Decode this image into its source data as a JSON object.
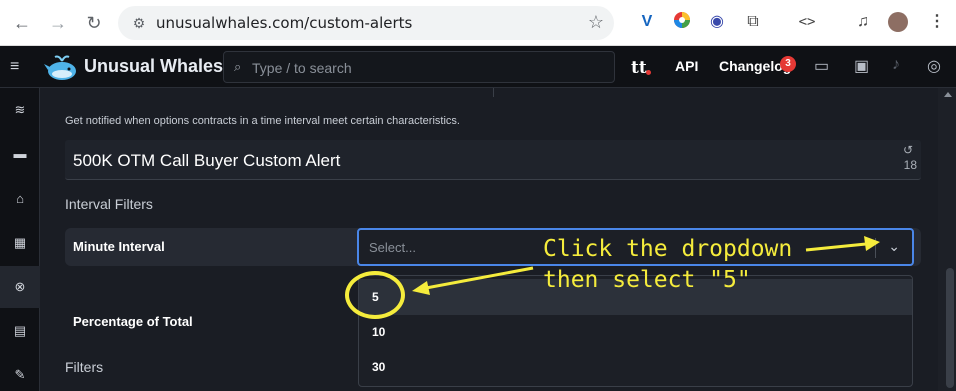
{
  "browser": {
    "url": "unusualwhales.com/custom-alerts",
    "back_icon": "←",
    "forward_icon": "→",
    "reload_icon": "↻",
    "site_icon": "⚙",
    "star_icon": "☆"
  },
  "header": {
    "menu_icon": "≡",
    "logo_text": "Unusual Whales",
    "search_icon": "⌕",
    "search_placeholder": "Type / to search",
    "tt_label": "tt",
    "api_label": "API",
    "changelog_label": "Changelog",
    "changelog_badge": "3"
  },
  "form": {
    "description": "Get notified when options contracts in a time interval meet certain characteristics.",
    "alert_name": "500K OTM Call Buyer Custom Alert",
    "reset_icon": "↺",
    "char_count": "18",
    "interval_filters_title": "Interval Filters",
    "minute_interval_label": "Minute Interval",
    "select_placeholder": "Select...",
    "percentage_label": "Percentage of Total",
    "filters_title": "Filters",
    "options": [
      "5",
      "10",
      "30"
    ]
  },
  "annotation": {
    "line1": "Click the dropdown",
    "line2": "then select \"5\"",
    "color": "#f5ec3c"
  }
}
